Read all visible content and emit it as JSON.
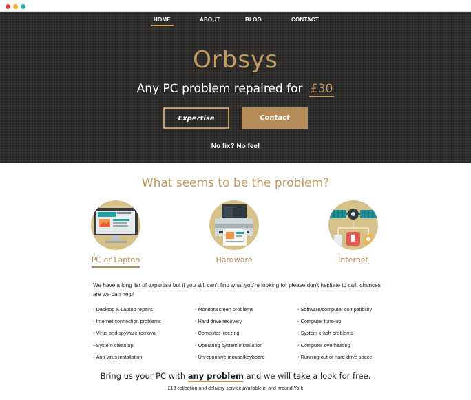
{
  "colors": {
    "gold": "#c39a5f",
    "dark_bg": "#2e2d2c",
    "circle": "#d6c189"
  },
  "window_controls": [
    "close-dot",
    "minimize-dot",
    "maximize-dot"
  ],
  "nav": {
    "items": [
      "HOME",
      "ABOUT",
      "BLOG",
      "CONTACT"
    ],
    "active": "HOME"
  },
  "hero": {
    "brand": "Orbsys",
    "tagline_prefix": "Any PC problem repaired for",
    "price": "£30",
    "button_expertise": "Expertise",
    "button_contact": "Contact",
    "no_fix": "No fix? No fee!"
  },
  "problems": {
    "title": "What seems to be the problem?",
    "categories": [
      {
        "label": "PC or Laptop",
        "icon": "monitor-icon",
        "active": true
      },
      {
        "label": "Hardware",
        "icon": "printer-icon",
        "active": false
      },
      {
        "label": "Internet",
        "icon": "satellite-icon",
        "active": false
      }
    ],
    "intro": "We have a long list of expertise but if you still can't find what you're looking for please don't hesitate to call, chances are we can help!",
    "columns": [
      [
        "Desktop & Laptop repairs",
        "Internet connection problems",
        "Virus and spyware removal",
        "System clean up",
        "Anti-virus installation"
      ],
      [
        "Monitor/screen problems",
        "Hard drive recovery",
        "Computer freezing",
        "Operating system installation",
        "Unreponsive mouse/keyboard"
      ],
      [
        "Software/computer compatibility",
        "Computer tune-up",
        "System crash problems",
        "Computer overheating",
        "Running out of hard-drive space"
      ]
    ]
  },
  "footer": {
    "bring_prefix": "Bring us your PC with",
    "bring_highlight": "any problem",
    "bring_suffix": "and we will take a look for free.",
    "delivery": "£10 collection and delivery service available in and around York"
  }
}
